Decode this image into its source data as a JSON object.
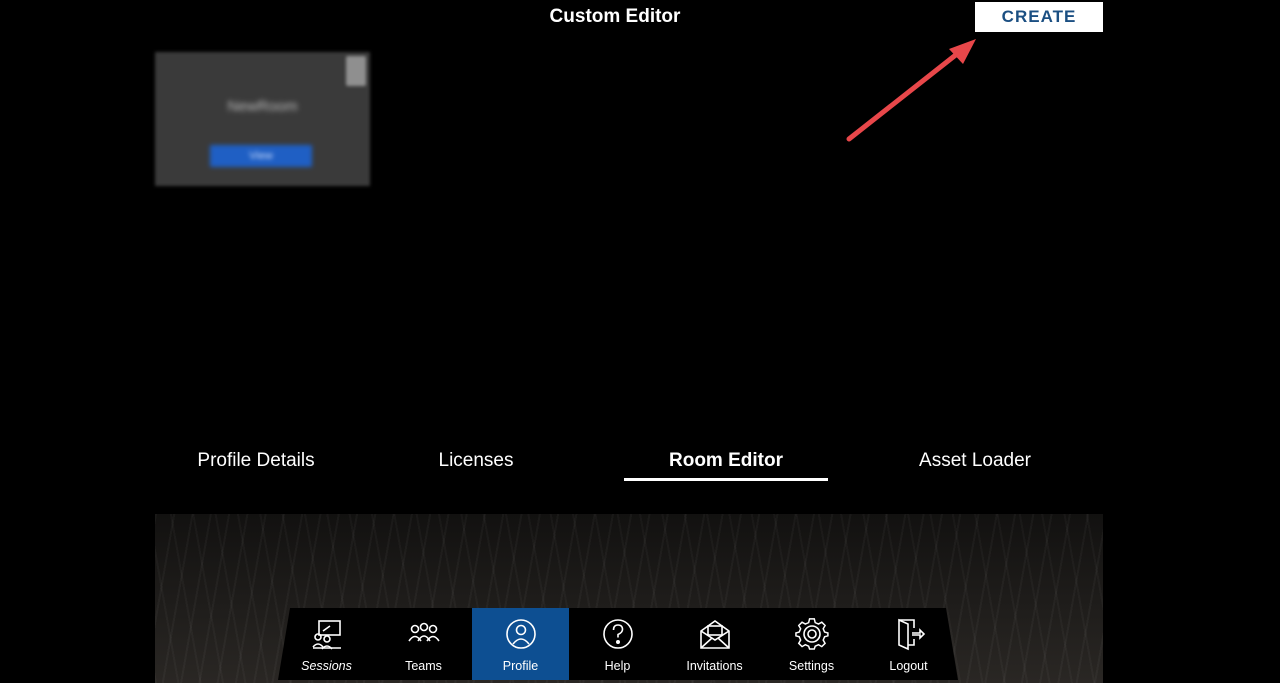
{
  "header": {
    "title": "Custom Editor",
    "create_label": "CREATE"
  },
  "room_card": {
    "name": "NewRoom",
    "view_label": "View"
  },
  "tabs": [
    {
      "label": "Profile Details",
      "active": false
    },
    {
      "label": "Licenses",
      "active": false
    },
    {
      "label": "Room Editor",
      "active": true
    },
    {
      "label": "Asset Loader",
      "active": false
    }
  ],
  "nav": [
    {
      "label": "Sessions",
      "icon": "sessions-icon",
      "active": false
    },
    {
      "label": "Teams",
      "icon": "teams-icon",
      "active": false
    },
    {
      "label": "Profile",
      "icon": "profile-icon",
      "active": true
    },
    {
      "label": "Help",
      "icon": "help-icon",
      "active": false
    },
    {
      "label": "Invitations",
      "icon": "invitations-icon",
      "active": false
    },
    {
      "label": "Settings",
      "icon": "settings-icon",
      "active": false
    },
    {
      "label": "Logout",
      "icon": "logout-icon",
      "active": false
    }
  ],
  "colors": {
    "background": "#000000",
    "create_text": "#1b4f82",
    "nav_active": "#0d4f92",
    "annotation_arrow": "#e8474a",
    "view_button": "#1f5fc4"
  }
}
